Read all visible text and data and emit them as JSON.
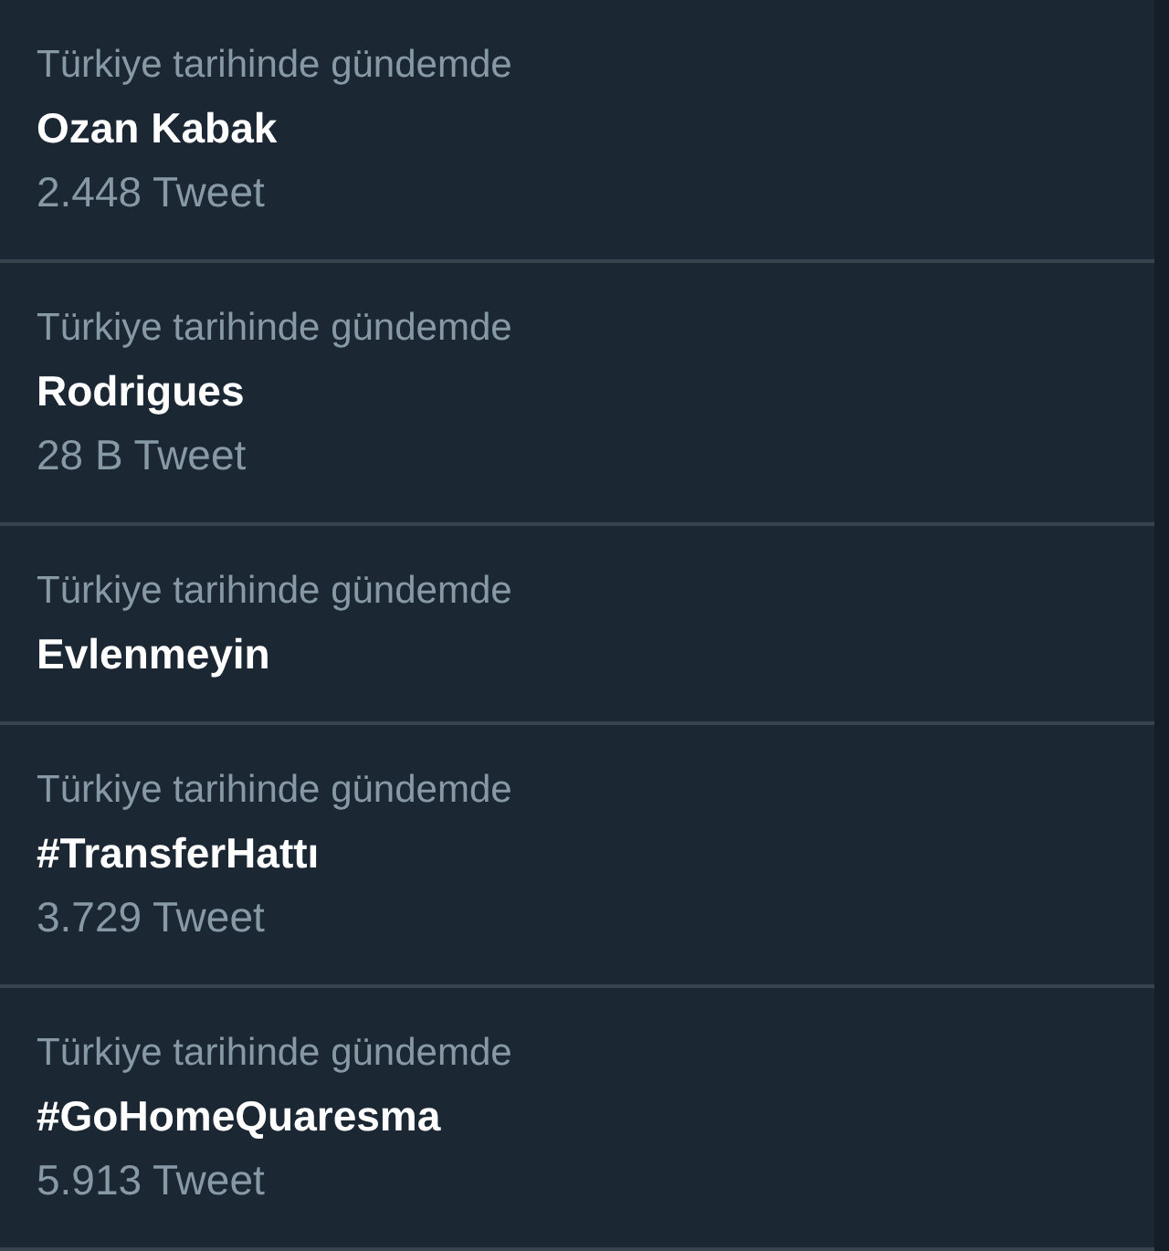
{
  "trends": [
    {
      "context": "Türkiye tarihinde gündemde",
      "name": "Ozan Kabak",
      "count": "2.448 Tweet"
    },
    {
      "context": "Türkiye tarihinde gündemde",
      "name": "Rodrigues",
      "count": "28 B Tweet"
    },
    {
      "context": "Türkiye tarihinde gündemde",
      "name": "Evlenmeyin"
    },
    {
      "context": "Türkiye tarihinde gündemde",
      "name": "#TransferHattı",
      "count": "3.729 Tweet"
    },
    {
      "context": "Türkiye tarihinde gündemde",
      "name": "#GoHomeQuaresma",
      "count": "5.913 Tweet"
    }
  ]
}
